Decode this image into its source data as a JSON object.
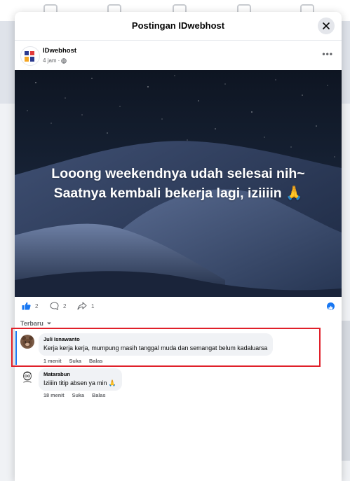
{
  "modal": {
    "title": "Postingan IDwebhost"
  },
  "post": {
    "author": "IDwebhost",
    "time": "4 jam",
    "separator": "·",
    "audience_icon": "globe-icon",
    "caption_line1": "Looong weekendnya udah selesai nih~",
    "caption_line2": "Saatnya kembali bekerja lagi, iziiiin 🙏",
    "counts": {
      "likes": "2",
      "comments": "2",
      "shares": "1"
    }
  },
  "comments_section": {
    "sort_label": "Terbaru",
    "items": [
      {
        "author": "Juli Isnawanto",
        "text": "Kerja kerja kerja, mumpung masih tanggal muda dan semangat belum kadaluarsa",
        "time": "1 menit",
        "like": "Suka",
        "reply": "Balas"
      },
      {
        "author": "Matarabun",
        "text": "Iziiiin titip absen ya min 🙏",
        "time": "18 menit",
        "like": "Suka",
        "reply": "Balas"
      }
    ]
  },
  "colors": {
    "accent": "#1877f2",
    "highlight": "#e0202a",
    "bubble": "#f0f2f5"
  }
}
